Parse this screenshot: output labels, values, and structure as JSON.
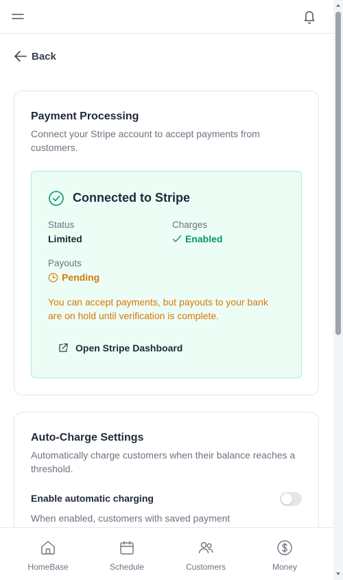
{
  "nav": {
    "back_label": "Back"
  },
  "payment": {
    "title": "Payment Processing",
    "description": "Connect your Stripe account to accept payments from customers.",
    "stripe": {
      "heading": "Connected to Stripe",
      "status_label": "Status",
      "status_value": "Limited",
      "charges_label": "Charges",
      "charges_value": "Enabled",
      "payouts_label": "Payouts",
      "payouts_value": "Pending",
      "warning": "You can accept payments, but payouts to your bank are on hold until verification is complete.",
      "dashboard_button": "Open Stripe Dashboard"
    }
  },
  "autocharge": {
    "title": "Auto-Charge Settings",
    "description": "Automatically charge customers when their balance reaches a threshold.",
    "toggle_label": "Enable automatic charging",
    "toggle_on": false,
    "toggle_help": "When enabled, customers with saved payment"
  },
  "bottom_nav": {
    "items": [
      {
        "label": "HomeBase",
        "icon": "home-icon"
      },
      {
        "label": "Schedule",
        "icon": "calendar-icon"
      },
      {
        "label": "Customers",
        "icon": "users-icon"
      },
      {
        "label": "Money",
        "icon": "dollar-circle-icon"
      }
    ]
  },
  "colors": {
    "success": "#059669",
    "warning": "#d97706",
    "success_bg": "#ecfdf5",
    "success_border": "#a7f3d0"
  }
}
